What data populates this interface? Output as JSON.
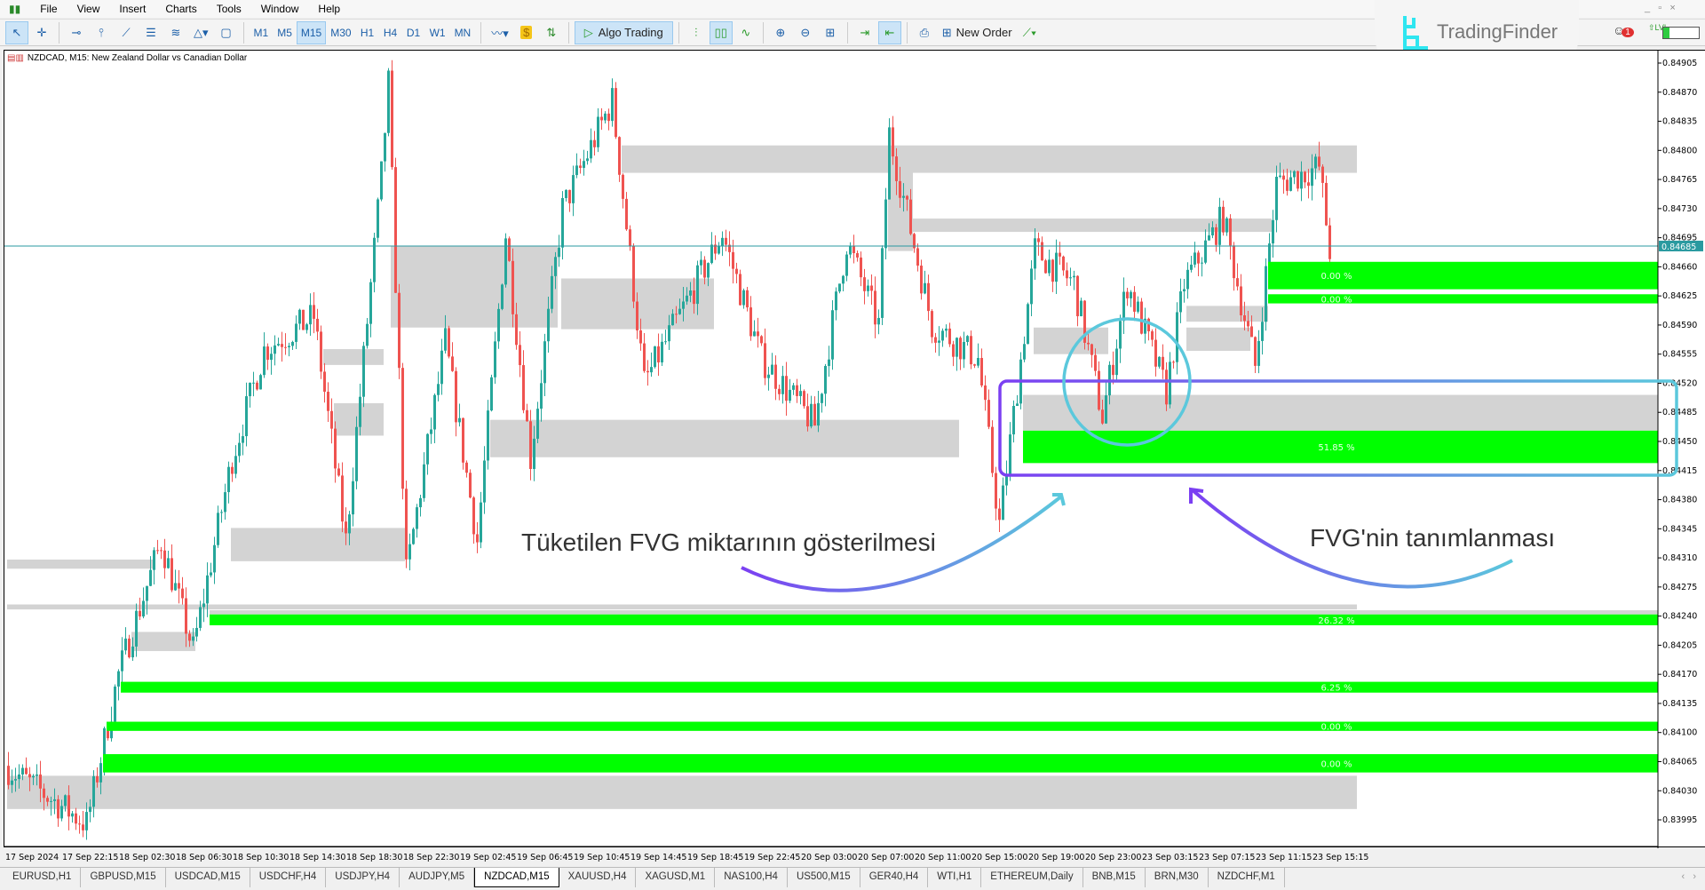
{
  "menu": [
    "File",
    "View",
    "Insert",
    "Charts",
    "Tools",
    "Window",
    "Help"
  ],
  "toolbar": {
    "timeframes": [
      "M1",
      "M5",
      "M15",
      "M30",
      "H1",
      "H4",
      "D1",
      "W1",
      "MN"
    ],
    "active_timeframe": "M15",
    "algo_trading": "Algo Trading",
    "new_order": "New Order"
  },
  "logo": {
    "text": "TradingFinder",
    "notifications": "1"
  },
  "chart": {
    "title": "NZDCAD, M15:  New Zealand Dollar vs Canadian Dollar",
    "current_price": "0.84685"
  },
  "colors": {
    "bull": "#26a69a",
    "bear": "#ef5350",
    "fvg": "#00ff00",
    "consumed": "#d3d3d3",
    "price_line": "#2a9aa0",
    "annotation_purple": "#7b3ff2",
    "annotation_cyan": "#5bc8dc"
  },
  "annotations": {
    "left_text": "Tüketilen FVG miktarının gösterilmesi",
    "right_text": "FVG'nin tanımlanması"
  },
  "chart_data": {
    "type": "candlestick",
    "timeframe": "M15",
    "ylim": [
      0.83995,
      0.84905
    ],
    "y_ticks": [
      "0.84905",
      "0.84870",
      "0.84835",
      "0.84800",
      "0.84765",
      "0.84730",
      "0.84695",
      "0.84660",
      "0.84625",
      "0.84590",
      "0.84555",
      "0.84520",
      "0.84485",
      "0.84450",
      "0.84415",
      "0.84380",
      "0.84345",
      "0.84310",
      "0.84275",
      "0.84240",
      "0.84205",
      "0.84170",
      "0.84135",
      "0.84100",
      "0.84065",
      "0.84030",
      "0.83995"
    ],
    "x_ticks": [
      "17 Sep 2024",
      "17 Sep 22:15",
      "18 Sep 02:30",
      "18 Sep 06:30",
      "18 Sep 10:30",
      "18 Sep 14:30",
      "18 Sep 18:30",
      "18 Sep 22:30",
      "19 Sep 02:45",
      "19 Sep 06:45",
      "19 Sep 10:45",
      "19 Sep 14:45",
      "19 Sep 18:45",
      "19 Sep 22:45",
      "20 Sep 03:00",
      "20 Sep 07:00",
      "20 Sep 11:00",
      "20 Sep 15:00",
      "20 Sep 19:00",
      "20 Sep 23:00",
      "23 Sep 03:15",
      "23 Sep 07:15",
      "23 Sep 11:15",
      "23 Sep 15:15"
    ],
    "price_path": [
      [
        0,
        0.8406
      ],
      [
        23,
        0.8399
      ],
      [
        32,
        0.8417
      ],
      [
        44,
        0.8433
      ],
      [
        53,
        0.842
      ],
      [
        64,
        0.8443
      ],
      [
        73,
        0.8456
      ],
      [
        87,
        0.846
      ],
      [
        96,
        0.8433
      ],
      [
        106,
        0.8477
      ],
      [
        108,
        0.8488
      ],
      [
        113,
        0.8429
      ],
      [
        124,
        0.8457
      ],
      [
        133,
        0.8433
      ],
      [
        141,
        0.847
      ],
      [
        148,
        0.8443
      ],
      [
        157,
        0.8473
      ],
      [
        171,
        0.8486
      ],
      [
        180,
        0.8452
      ],
      [
        202,
        0.847
      ],
      [
        213,
        0.8455
      ],
      [
        228,
        0.8447
      ],
      [
        237,
        0.8469
      ],
      [
        246,
        0.8459
      ],
      [
        249,
        0.8482
      ],
      [
        261,
        0.8459
      ],
      [
        274,
        0.8455
      ],
      [
        280,
        0.8435
      ],
      [
        290,
        0.8468
      ],
      [
        301,
        0.8464
      ],
      [
        309,
        0.8448
      ],
      [
        316,
        0.8464
      ],
      [
        327,
        0.8451
      ],
      [
        332,
        0.8464
      ],
      [
        343,
        0.8472
      ],
      [
        352,
        0.8454
      ],
      [
        358,
        0.8476
      ],
      [
        370,
        0.8478
      ],
      [
        373,
        0.8468
      ]
    ],
    "fvg_zones": [
      {
        "top": 0.84666,
        "bottom": 0.84633,
        "start": 355,
        "label": "0.00 %"
      },
      {
        "top": 0.84627,
        "bottom": 0.84616,
        "start": 355,
        "label": "0.00 %"
      },
      {
        "top": 0.84463,
        "bottom": 0.84424,
        "start": 286,
        "label": "51.85 %",
        "consumed_top": 0.84506
      },
      {
        "top": 0.84242,
        "bottom": 0.84229,
        "start": 57,
        "label": "26.32 %",
        "consumed_top": 0.84247
      },
      {
        "top": 0.84161,
        "bottom": 0.84148,
        "start": 32,
        "label": "6.25 %"
      },
      {
        "top": 0.84113,
        "bottom": 0.84102,
        "start": 28,
        "label": "0.00 %"
      },
      {
        "top": 0.84074,
        "bottom": 0.84052,
        "start": 27,
        "label": "0.00 %"
      }
    ],
    "consumed_zones": [
      [
        0.84048,
        0.84008,
        0,
        380
      ],
      [
        0.84806,
        0.84773,
        173,
        380
      ],
      [
        0.84718,
        0.84702,
        255,
        356
      ],
      [
        0.84476,
        0.84431,
        136,
        268
      ],
      [
        0.84685,
        0.84587,
        108,
        155
      ],
      [
        0.84646,
        0.84585,
        156,
        199
      ],
      [
        0.84346,
        0.84306,
        63,
        112
      ],
      [
        0.84496,
        0.84457,
        92,
        106
      ],
      [
        0.84561,
        0.84542,
        89,
        106
      ],
      [
        0.84308,
        0.84297,
        0,
        41
      ],
      [
        0.84221,
        0.84198,
        35,
        53
      ],
      [
        0.84254,
        0.84248,
        0,
        380
      ],
      [
        0.84587,
        0.84555,
        289,
        310
      ],
      [
        0.84613,
        0.84594,
        332,
        355
      ],
      [
        0.84587,
        0.84559,
        332,
        350
      ],
      [
        0.84777,
        0.84679,
        248,
        255
      ]
    ]
  },
  "tabs": [
    "EURUSD,H1",
    "GBPUSD,M15",
    "USDCAD,M15",
    "USDCHF,H4",
    "USDJPY,H4",
    "AUDJPY,M5",
    "NZDCAD,M15",
    "XAUUSD,H4",
    "XAGUSD,M1",
    "NAS100,H4",
    "US500,M15",
    "GER40,H4",
    "WTI,H1",
    "ETHEREUM,Daily",
    "BNB,M15",
    "BRN,M30",
    "NZDCHF,M1"
  ],
  "active_tab": "NZDCAD,M15"
}
